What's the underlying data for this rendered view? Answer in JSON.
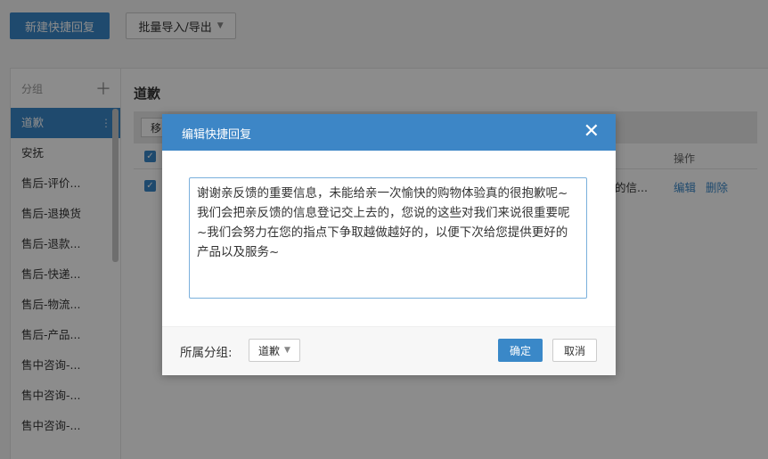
{
  "top": {
    "new_button": "新建快捷回复",
    "import_export": "批量导入/导出"
  },
  "sidebar": {
    "header": "分组",
    "items": [
      {
        "label": "道歉"
      },
      {
        "label": "安抚"
      },
      {
        "label": "售后-评价..."
      },
      {
        "label": "售后-退换货"
      },
      {
        "label": "售后-退款..."
      },
      {
        "label": "售后-快递..."
      },
      {
        "label": "售后-物流..."
      },
      {
        "label": "售后-产品..."
      },
      {
        "label": "售中咨询-..."
      },
      {
        "label": "售中咨询-..."
      },
      {
        "label": "售中咨询-..."
      }
    ]
  },
  "main": {
    "title": "道歉",
    "toolbar_btn": "移",
    "ops_header": "操作",
    "row": {
      "text": "的信...",
      "edit": "编辑",
      "delete": "删除"
    }
  },
  "modal": {
    "title": "编辑快捷回复",
    "content": "谢谢亲反馈的重要信息，未能给亲一次愉快的购物体验真的很抱歉呢~我们会把亲反馈的信息登记交上去的，您说的这些对我们来说很重要呢~我们会努力在您的指点下争取越做越好的，以便下次给您提供更好的产品以及服务~",
    "group_label": "所属分组:",
    "group_value": "道歉",
    "ok": "确定",
    "cancel": "取消"
  },
  "colors": {
    "accent": "#3a88c8",
    "modal_header": "#3d86c6"
  }
}
